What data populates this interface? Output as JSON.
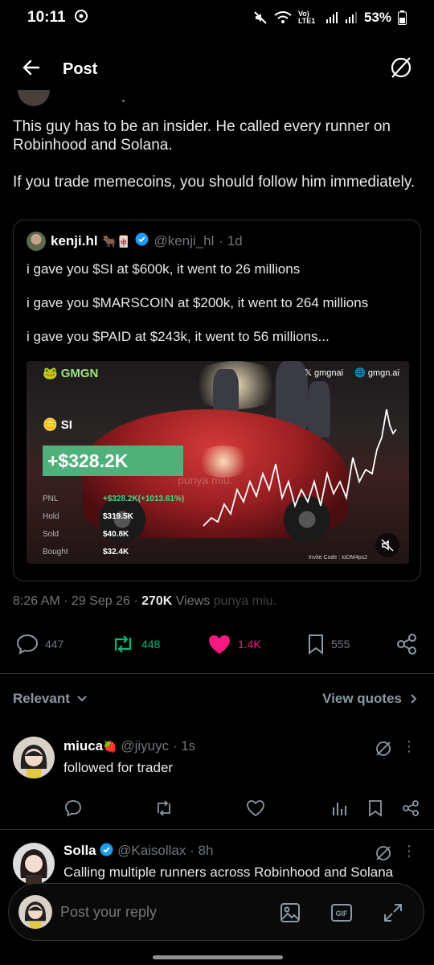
{
  "status": {
    "time": "10:11",
    "battery": "53%",
    "network_label": "Vo) LTE1"
  },
  "header": {
    "title": "Post"
  },
  "post": {
    "text_lines": [
      "This guy has to be an insider. He called every runner on Robinhood and Solana.",
      "If you trade memecoins, you should follow him immediately."
    ],
    "quote": {
      "name": "kenji.hl",
      "emoji": "🐂🀄",
      "handle": "@kenji_hl",
      "age": "· 1d",
      "lines": [
        "i gave you $SI at $600k, it went to 26 millions",
        "i gave you $MARSCOIN at $200k, it went to 264 millions",
        "i gave you $PAID at $243k, it went to 56 millions..."
      ],
      "media": {
        "brand": "GMGN",
        "x_link": "gmgnai",
        "site_link": "gmgn.ai",
        "token": "SI",
        "pnl_big": "+$328.2K",
        "rows": [
          {
            "k": "PNL",
            "v": "+$328.2K(+1013.61%)",
            "green": true
          },
          {
            "k": "Hold",
            "v": "$319.5K"
          },
          {
            "k": "Sold",
            "v": "$40.8K"
          },
          {
            "k": "Bought",
            "v": "$32.4K"
          }
        ],
        "invite": "Invite Code : toDM4ps2",
        "watermark": "punya miu."
      }
    },
    "meta": {
      "time": "8:26 AM",
      "date": "29 Sep 26",
      "views_count": "270K",
      "views_label": "Views",
      "watermark": "punya miu."
    },
    "actions": {
      "replies": "447",
      "reposts": "448",
      "likes": "1.4K",
      "bookmarks": "555"
    }
  },
  "filters": {
    "relevant": "Relevant",
    "view_quotes": "View quotes"
  },
  "replies": [
    {
      "name": "miuca",
      "emoji": "🍓",
      "handle": "@jiyuyc",
      "age": "· 1s",
      "text": "followed for trader"
    },
    {
      "name": "Solla",
      "verified": true,
      "handle": "@Kaisollax",
      "age": "· 8h",
      "text": "Calling multiple runners across Robinhood and Solana"
    }
  ],
  "composer": {
    "placeholder": "Post your reply"
  },
  "colors": {
    "background": "#000000",
    "text": "#e7e9ea",
    "muted": "#71767b",
    "repost_green": "#00ba7c",
    "like_pink": "#f91880",
    "verified_blue": "#1d9bf0",
    "pnl_green": "#4fb07a"
  }
}
